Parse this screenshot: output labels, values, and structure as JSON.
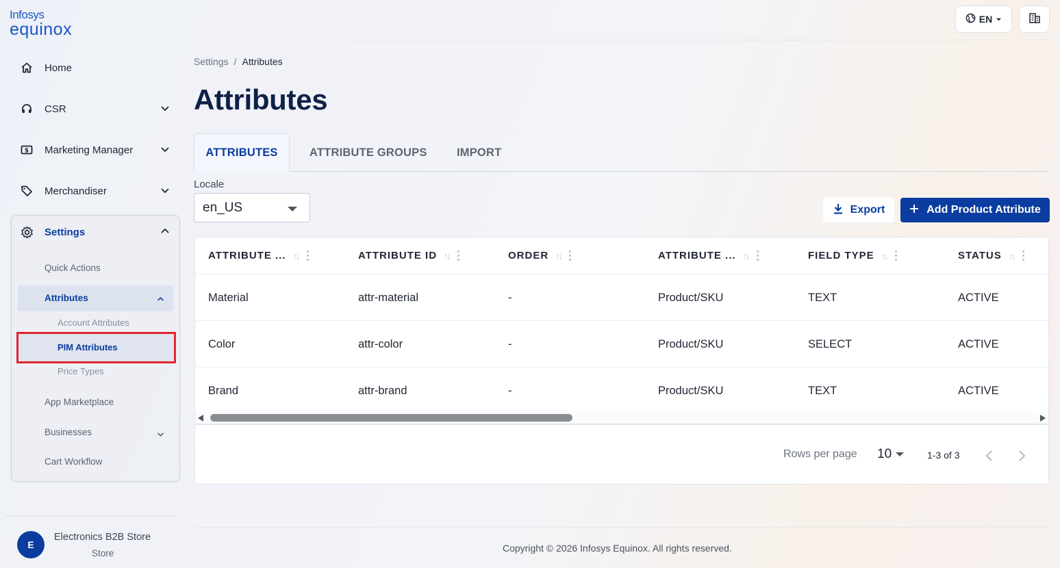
{
  "brand": {
    "line1": "Infosys",
    "line2": "equinox"
  },
  "sidebar": {
    "items": [
      {
        "label": "Home",
        "icon": "home-icon"
      },
      {
        "label": "CSR",
        "icon": "headset-icon"
      },
      {
        "label": "Marketing Manager",
        "icon": "dollar-icon"
      },
      {
        "label": "Merchandiser",
        "icon": "tag-icon"
      },
      {
        "label": "Settings",
        "icon": "gear-icon"
      }
    ],
    "settings_children": {
      "quick_actions": "Quick Actions",
      "attributes": "Attributes",
      "account_attributes": "Account Attributes",
      "pim_attributes": "PIM Attributes",
      "price_types": "Price Types",
      "app_marketplace": "App Marketplace",
      "businesses": "Businesses",
      "cart_workflow": "Cart Workflow"
    },
    "store": {
      "avatar": "E",
      "name": "Electronics B2B Store",
      "type": "Store"
    }
  },
  "topbar": {
    "language": "EN"
  },
  "breadcrumb": {
    "parent": "Settings",
    "separator": "/",
    "current": "Attributes"
  },
  "page_title": "Attributes",
  "tabs": [
    "ATTRIBUTES",
    "ATTRIBUTE GROUPS",
    "IMPORT"
  ],
  "locale": {
    "label": "Locale",
    "value": "en_US"
  },
  "actions": {
    "export": "Export",
    "add": "Add Product Attribute"
  },
  "table": {
    "columns": [
      "ATTRIBUTE ...",
      "ATTRIBUTE ID",
      "ORDER",
      "ATTRIBUTE ...",
      "FIELD TYPE",
      "STATUS"
    ],
    "rows": [
      [
        "Material",
        "attr-material",
        "-",
        "Product/SKU",
        "TEXT",
        "ACTIVE"
      ],
      [
        "Color",
        "attr-color",
        "-",
        "Product/SKU",
        "SELECT",
        "ACTIVE"
      ],
      [
        "Brand",
        "attr-brand",
        "-",
        "Product/SKU",
        "TEXT",
        "ACTIVE"
      ]
    ]
  },
  "pagination": {
    "rows_per_page_label": "Rows per page",
    "rows_per_page": "10",
    "range": "1-3 of 3"
  },
  "footer": {
    "copyright": "Copyright © 2026 Infosys Equinox. All rights reserved."
  },
  "colors": {
    "primary": "#0a3d9f",
    "highlight_border": "#e0262c",
    "title": "#0f2147"
  }
}
